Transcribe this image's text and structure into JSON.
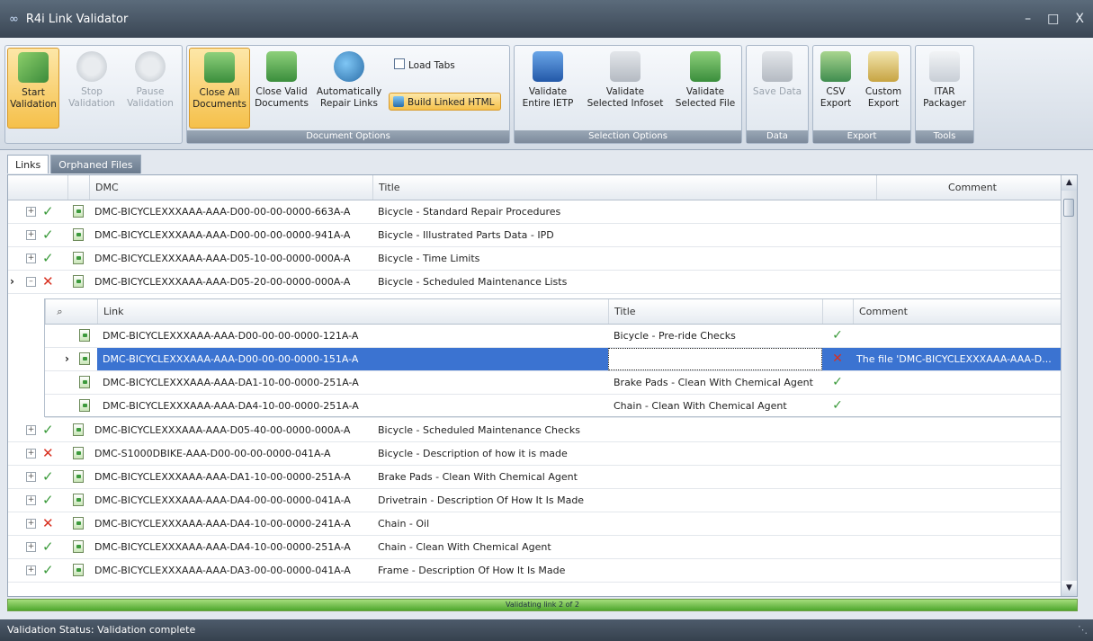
{
  "window": {
    "title": "R4i Link Validator",
    "controls": [
      "–",
      "□",
      "X"
    ]
  },
  "ribbon": {
    "validation": {
      "start": [
        "Start",
        "Validation"
      ],
      "stop": [
        "Stop",
        "Validation"
      ],
      "pause": [
        "Pause",
        "Validation"
      ]
    },
    "document_options": {
      "label": "Document Options",
      "close_all": [
        "Close All",
        "Documents"
      ],
      "close_valid": [
        "Close Valid",
        "Documents"
      ],
      "auto_repair": [
        "Automatically",
        "Repair Links"
      ],
      "load_tabs": "Load Tabs",
      "build_html": "Build Linked HTML"
    },
    "selection_options": {
      "label": "Selection Options",
      "entire": [
        "Validate",
        "Entire IETP"
      ],
      "infoset": [
        "Validate",
        "Selected Infoset"
      ],
      "file": [
        "Validate",
        "Selected File"
      ]
    },
    "data": {
      "label": "Data",
      "save": "Save Data"
    },
    "export": {
      "label": "Export",
      "csv": [
        "CSV",
        "Export"
      ],
      "custom": [
        "Custom",
        "Export"
      ]
    },
    "tools": {
      "label": "Tools",
      "itar": [
        "ITAR",
        "Packager"
      ]
    }
  },
  "tabs": [
    "Links",
    "Orphaned Files"
  ],
  "grid": {
    "columns": {
      "dmc": "DMC",
      "title": "Title",
      "comment": "Comment"
    },
    "rows_top": [
      {
        "expander": "⊞",
        "status": "ok",
        "dmc": "DMC-BICYCLEXXXAAA-AAA-D00-00-00-0000-663A-A",
        "title": "Bicycle - Standard Repair Procedures"
      },
      {
        "expander": "⊞",
        "status": "ok",
        "dmc": "DMC-BICYCLEXXXAAA-AAA-D00-00-00-0000-941A-A",
        "title": "Bicycle - Illustrated Parts Data - IPD"
      },
      {
        "expander": "⊞",
        "status": "ok",
        "dmc": "DMC-BICYCLEXXXAAA-AAA-D05-10-00-0000-000A-A",
        "title": "Bicycle - Time Limits"
      },
      {
        "expander": "⊟",
        "status": "bad",
        "dmc": "DMC-BICYCLEXXXAAA-AAA-D05-20-00-0000-000A-A",
        "title": "Bicycle - Scheduled Maintenance Lists",
        "current": "›"
      }
    ],
    "subgrid": {
      "columns": {
        "filter": "⌕",
        "link": "Link",
        "title": "Title",
        "comment": "Comment"
      },
      "rows": [
        {
          "link": "DMC-BICYCLEXXXAAA-AAA-D00-00-00-0000-121A-A",
          "title": "Bicycle - Pre-ride Checks",
          "status": "ok",
          "comment": ""
        },
        {
          "link": "DMC-BICYCLEXXXAAA-AAA-D00-00-00-0000-151A-A",
          "title": "",
          "status": "bad",
          "comment": "The file 'DMC-BICYCLEXXXAAA-AAA-D...",
          "selected": true,
          "current": "›"
        },
        {
          "link": "DMC-BICYCLEXXXAAA-AAA-DA1-10-00-0000-251A-A",
          "title": "Brake Pads - Clean With Chemical Agent",
          "status": "ok",
          "comment": ""
        },
        {
          "link": "DMC-BICYCLEXXXAAA-AAA-DA4-10-00-0000-251A-A",
          "title": "Chain - Clean With Chemical Agent",
          "status": "ok",
          "comment": ""
        }
      ]
    },
    "rows_bottom": [
      {
        "expander": "⊞",
        "status": "ok",
        "dmc": "DMC-BICYCLEXXXAAA-AAA-D05-40-00-0000-000A-A",
        "title": "Bicycle - Scheduled Maintenance Checks"
      },
      {
        "expander": "⊞",
        "status": "bad",
        "dmc": "DMC-S1000DBIKE-AAA-D00-00-00-0000-041A-A",
        "title": "Bicycle - Description of how it is made"
      },
      {
        "expander": "⊞",
        "status": "ok",
        "dmc": "DMC-BICYCLEXXXAAA-AAA-DA1-10-00-0000-251A-A",
        "title": "Brake Pads - Clean With Chemical Agent"
      },
      {
        "expander": "⊞",
        "status": "ok",
        "dmc": "DMC-BICYCLEXXXAAA-AAA-DA4-00-00-0000-041A-A",
        "title": "Drivetrain - Description Of How It Is Made"
      },
      {
        "expander": "⊞",
        "status": "bad",
        "dmc": "DMC-BICYCLEXXXAAA-AAA-DA4-10-00-0000-241A-A",
        "title": "Chain - Oil"
      },
      {
        "expander": "⊞",
        "status": "ok",
        "dmc": "DMC-BICYCLEXXXAAA-AAA-DA4-10-00-0000-251A-A",
        "title": "Chain - Clean With Chemical Agent"
      },
      {
        "expander": "⊞",
        "status": "ok",
        "dmc": "DMC-BICYCLEXXXAAA-AAA-DA3-00-00-0000-041A-A",
        "title": "Frame - Description Of How It Is Made"
      }
    ]
  },
  "progress": {
    "fraction": 1.0,
    "text": "Validating link 2 of 2"
  },
  "status_bar": "Validation Status: Validation complete",
  "colors": {
    "ok": "#3a9a3a",
    "bad": "#d83020",
    "selection": "#3b73d1",
    "progress": "#4ea72d"
  }
}
